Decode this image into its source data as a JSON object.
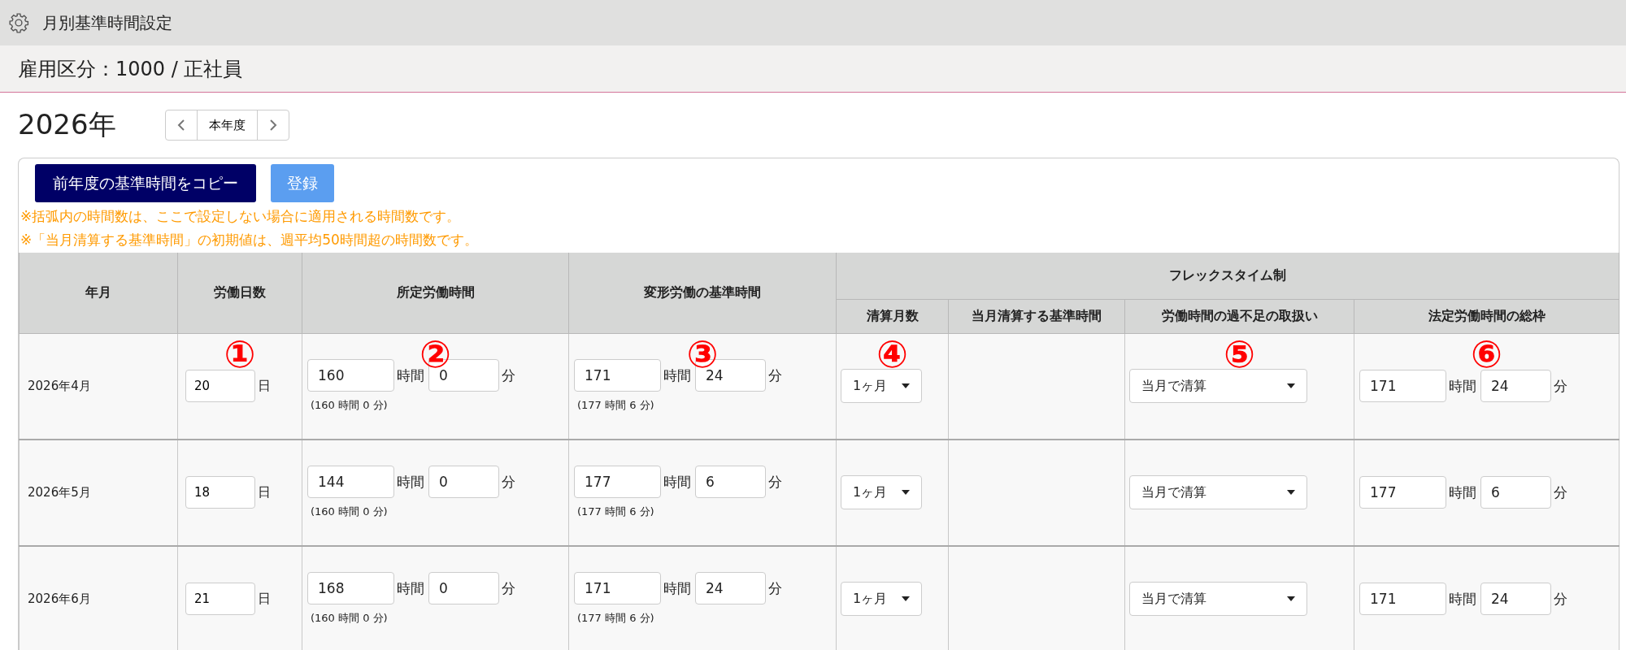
{
  "window": {
    "title": "月別基準時間設定"
  },
  "subheader": "雇用区分：1000 / 正社員",
  "year": "2026年",
  "year_nav": {
    "label": "本年度"
  },
  "buttons": [
    {
      "label": "前年度の基準時間をコピー",
      "kind": "primary"
    },
    {
      "label": "登録",
      "kind": "secondary"
    }
  ],
  "notes": [
    "※括弧内の時間数は、ここで設定しない場合に適用される時間数です。",
    "※「当月清算する基準時間」の初期値は、週平均50時間超の時間数です。"
  ],
  "table": {
    "columns": [
      {
        "label": "年月"
      },
      {
        "label": "労働日数",
        "marker": "①"
      },
      {
        "label": "所定労働時間",
        "marker": "②"
      },
      {
        "label": "変形労働の基準時間",
        "marker": "③"
      }
    ],
    "flex_group": {
      "label": "フレックスタイム制",
      "columns": [
        {
          "label": "清算月数",
          "marker": "④"
        },
        {
          "label": "当月清算する基準時間"
        },
        {
          "label": "労働時間の過不足の取扱い",
          "marker": "⑤"
        },
        {
          "label": "法定労働時間の総枠",
          "marker": "⑥"
        }
      ]
    },
    "rows": [
      {
        "month": "2026年4月",
        "days": {
          "value": "20",
          "unit": "日"
        },
        "scheduled": {
          "hours": "160",
          "hours_unit": "時間",
          "minutes": "0",
          "minutes_unit": "分",
          "default": "(160 時間 0 分)"
        },
        "variable": {
          "hours": "171",
          "hours_unit": "時間",
          "minutes": "24",
          "minutes_unit": "分",
          "default": "(177 時間 6 分)"
        },
        "settle_months": "1ヶ月",
        "shortfall": "当月で清算",
        "legal_total": {
          "hours": "171",
          "hours_unit": "時間",
          "minutes": "24",
          "minutes_unit": "分"
        }
      },
      {
        "month": "2026年5月",
        "days": {
          "value": "18",
          "unit": "日"
        },
        "scheduled": {
          "hours": "144",
          "hours_unit": "時間",
          "minutes": "0",
          "minutes_unit": "分",
          "default": "(160 時間 0 分)"
        },
        "variable": {
          "hours": "177",
          "hours_unit": "時間",
          "minutes": "6",
          "minutes_unit": "分",
          "default": "(177 時間 6 分)"
        },
        "settle_months": "1ヶ月",
        "shortfall": "当月で清算",
        "legal_total": {
          "hours": "177",
          "hours_unit": "時間",
          "minutes": "6",
          "minutes_unit": "分"
        }
      },
      {
        "month": "2026年6月",
        "days": {
          "value": "21",
          "unit": "日"
        },
        "scheduled": {
          "hours": "168",
          "hours_unit": "時間",
          "minutes": "0",
          "minutes_unit": "分",
          "default": "(160 時間 0 分)"
        },
        "variable": {
          "hours": "171",
          "hours_unit": "時間",
          "minutes": "24",
          "minutes_unit": "分",
          "default": "(177 時間 6 分)"
        },
        "settle_months": "1ヶ月",
        "shortfall": "当月で清算",
        "legal_total": {
          "hours": "171",
          "hours_unit": "時間",
          "minutes": "24",
          "minutes_unit": "分"
        }
      }
    ]
  }
}
